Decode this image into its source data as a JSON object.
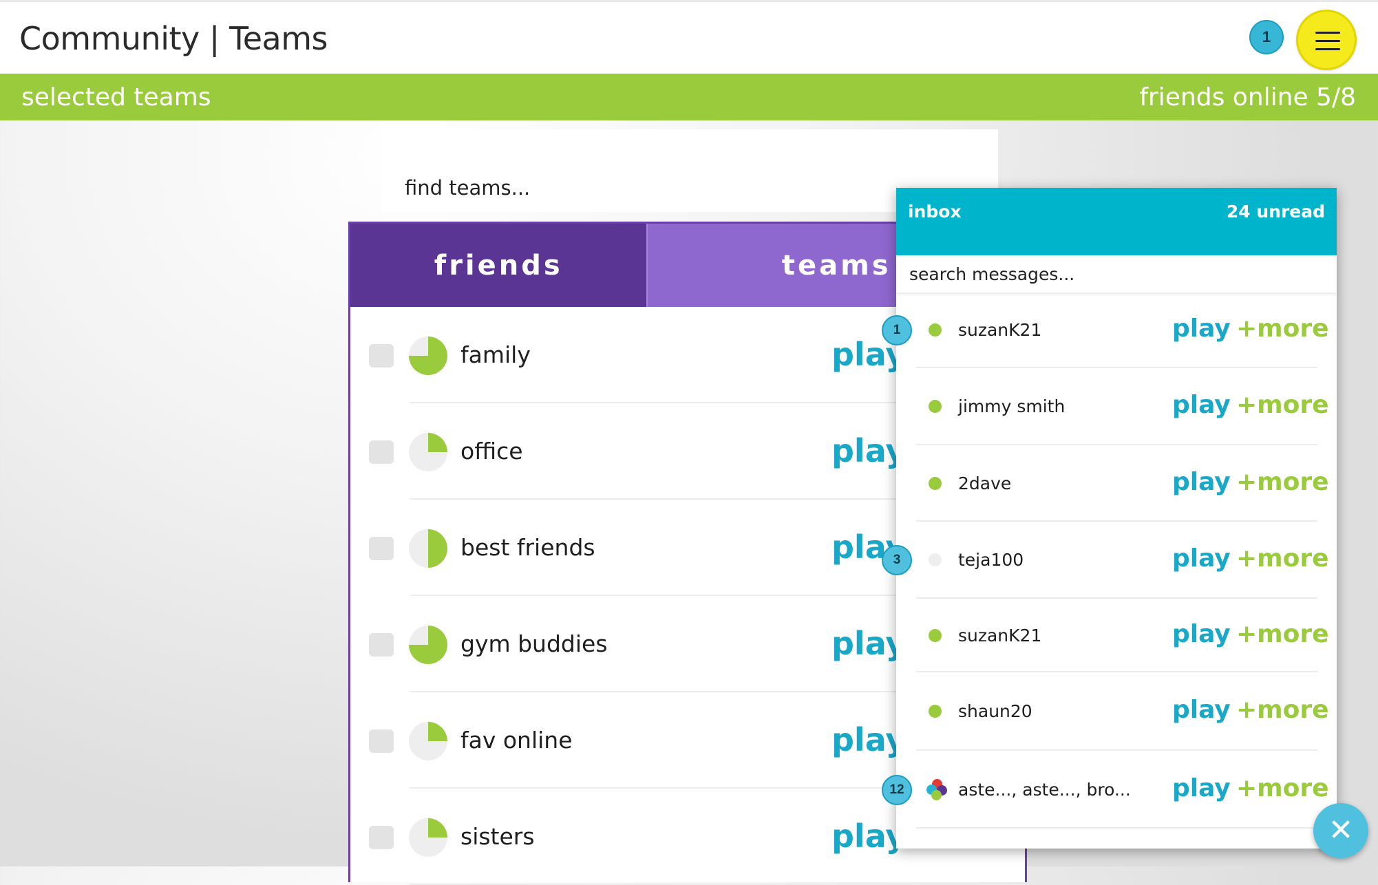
{
  "header": {
    "title": "Community | Teams",
    "notification_count": "1",
    "menu_icon": "hamburger-icon"
  },
  "subheader": {
    "left": "selected teams",
    "right": "friends online 5/8"
  },
  "search": {
    "placeholder": "find teams..."
  },
  "tabs": [
    {
      "label": "friends",
      "active": true
    },
    {
      "label": "teams",
      "active": false
    }
  ],
  "teams": [
    {
      "name": "family",
      "play": "play",
      "progress": 0.75
    },
    {
      "name": "office",
      "play": "play",
      "progress": 0.25
    },
    {
      "name": "best friends",
      "play": "play",
      "progress": 0.5
    },
    {
      "name": "gym buddies",
      "play": "play",
      "progress": 0.75
    },
    {
      "name": "fav online",
      "play": "play",
      "progress": 0.25
    },
    {
      "name": "sisters",
      "play": "play",
      "progress": 0.25
    }
  ],
  "inbox": {
    "title": "inbox",
    "unread": "24 unread",
    "search_placeholder": "search messages...",
    "messages": [
      {
        "user": "suzanK21",
        "status": "online",
        "badge": "1",
        "play": "play",
        "more": "+more"
      },
      {
        "user": "jimmy smith",
        "status": "online",
        "badge": "",
        "play": "play",
        "more": "+more"
      },
      {
        "user": "2dave",
        "status": "online",
        "badge": "",
        "play": "play",
        "more": "+more"
      },
      {
        "user": "teja100",
        "status": "offline",
        "badge": "3",
        "play": "play",
        "more": "+more"
      },
      {
        "user": "suzanK21",
        "status": "online",
        "badge": "",
        "play": "play",
        "more": "+more"
      },
      {
        "user": "shaun20",
        "status": "online",
        "badge": "",
        "play": "play",
        "more": "+more"
      },
      {
        "user": "aste..., aste..., bro...",
        "status": "group",
        "badge": "12",
        "play": "play",
        "more": "+more"
      }
    ]
  },
  "close_button": {
    "icon": "close-icon",
    "glyph": "✕"
  },
  "colors": {
    "accent_green": "#9acb3c",
    "accent_teal": "#1aa8c8",
    "inbox_header": "#00b4cb",
    "tab_friends": "#5b3594",
    "tab_teams": "#8e67cf",
    "menu_yellow": "#f4ea1c"
  }
}
